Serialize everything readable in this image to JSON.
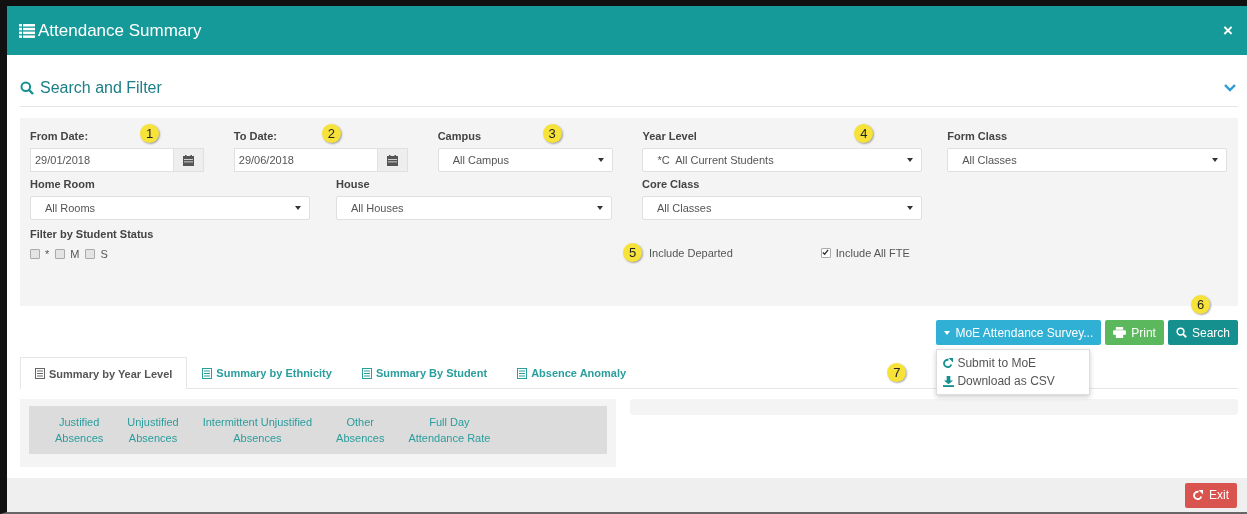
{
  "window": {
    "title": "Attendance Summary",
    "close": "×"
  },
  "search_panel": {
    "title": "Search and Filter",
    "expanded": true
  },
  "filters_row_1": [
    {
      "kind": "date",
      "label": "From Date:",
      "value": "29/01/2018",
      "callout": "1"
    },
    {
      "kind": "date",
      "label": "To Date:",
      "value": "29/06/2018",
      "callout": "2"
    },
    {
      "kind": "select",
      "label": "Campus",
      "value": "All Campus",
      "callout": "3"
    },
    {
      "kind": "select",
      "label": "Year Level",
      "value": "*C  All Current Students",
      "callout": "4"
    },
    {
      "kind": "select",
      "label": "Form Class",
      "value": "All Classes"
    }
  ],
  "filters_row_2": [
    {
      "kind": "select",
      "label": "Home Room",
      "value": "All Rooms"
    },
    {
      "kind": "select",
      "label": "House",
      "value": "All Houses"
    },
    {
      "kind": "select",
      "label": "Core Class",
      "value": "All Classes"
    }
  ],
  "student_status": {
    "label": "Filter by Student Status",
    "options": [
      {
        "label": "*",
        "checked": false
      },
      {
        "label": "M",
        "checked": false
      },
      {
        "label": "S",
        "checked": false
      }
    ]
  },
  "options": [
    {
      "label": "Include Departed",
      "callout": "5"
    },
    {
      "label": "Include All FTE",
      "checked": true
    }
  ],
  "actions": [
    {
      "kind": "dropdown",
      "label": "MoE Attendance Survey...",
      "expanded": true
    },
    {
      "kind": "print",
      "label": "Print"
    },
    {
      "kind": "search",
      "label": "Search",
      "callout": "6"
    }
  ],
  "dropdown_menu": {
    "items": [
      {
        "kind": "submit",
        "label": "Submit to MoE"
      },
      {
        "kind": "download",
        "label": "Download as CSV"
      }
    ],
    "callout": "7"
  },
  "tabs": [
    {
      "label": "Summary by Year Level",
      "selected": true
    },
    {
      "label": "Summary by Ethnicity",
      "selected": false
    },
    {
      "label": "Summary By Student",
      "selected": false
    },
    {
      "label": "Absence Anomaly",
      "selected": false
    }
  ],
  "table": {
    "columns": [
      [
        "Justified",
        "Absences"
      ],
      [
        "Unjustified",
        "Absences"
      ],
      [
        "Intermittent Unjustified",
        "Absences"
      ],
      [
        "Other",
        "Absences"
      ],
      [
        "Full Day",
        "Attendance Rate"
      ]
    ]
  },
  "footer": {
    "exit": "Exit"
  }
}
